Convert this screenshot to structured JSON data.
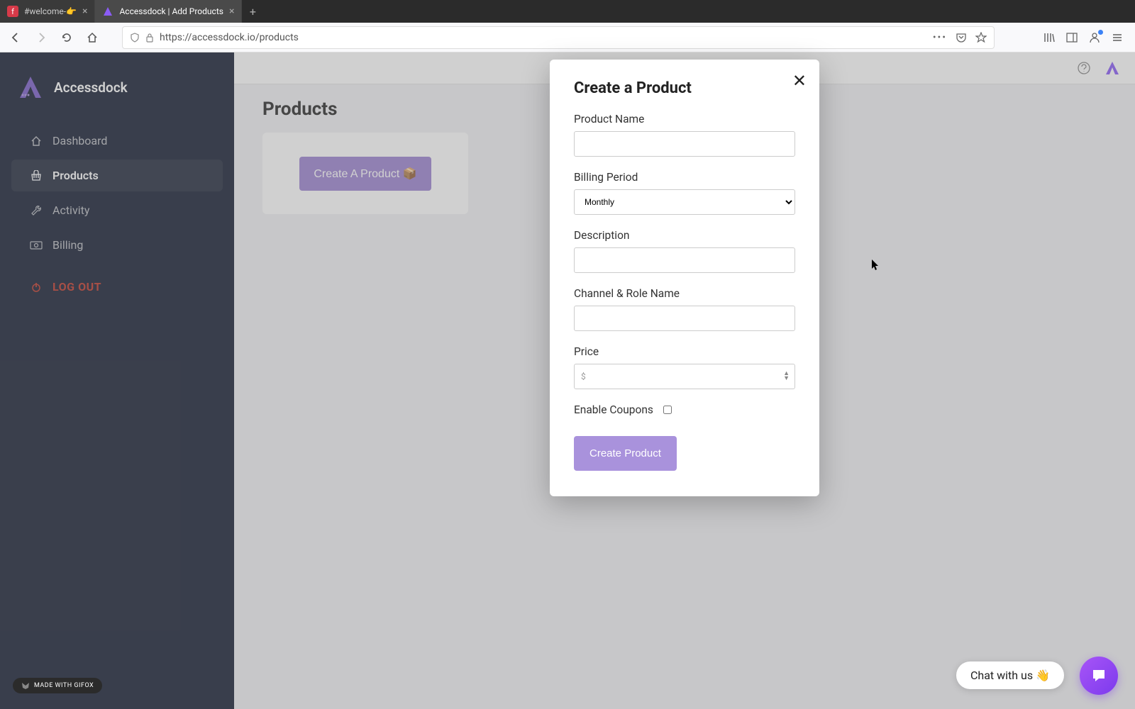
{
  "browser": {
    "tabs": [
      {
        "title": "#welcome-👉",
        "favicon_bg": "#d73a49"
      },
      {
        "title": "Accessdock | Add Products",
        "favicon_bg": "#8b5cf6"
      }
    ],
    "url": "https://accessdock.io/products"
  },
  "sidebar": {
    "brand": "Accessdock",
    "items": [
      {
        "label": "Dashboard"
      },
      {
        "label": "Products"
      },
      {
        "label": "Activity"
      },
      {
        "label": "Billing"
      }
    ],
    "logout": "LOG OUT"
  },
  "page": {
    "title": "Products",
    "create_button": "Create A Product 📦"
  },
  "modal": {
    "title": "Create a Product",
    "fields": {
      "product_name_label": "Product Name",
      "billing_period_label": "Billing Period",
      "billing_period_value": "Monthly",
      "description_label": "Description",
      "channel_role_label": "Channel & Role Name",
      "price_label": "Price",
      "price_prefix": "$",
      "enable_coupons_label": "Enable Coupons"
    },
    "submit": "Create Product"
  },
  "chat": {
    "pill": "Chat with us 👋"
  },
  "badge": "MADE WITH GIFOX"
}
